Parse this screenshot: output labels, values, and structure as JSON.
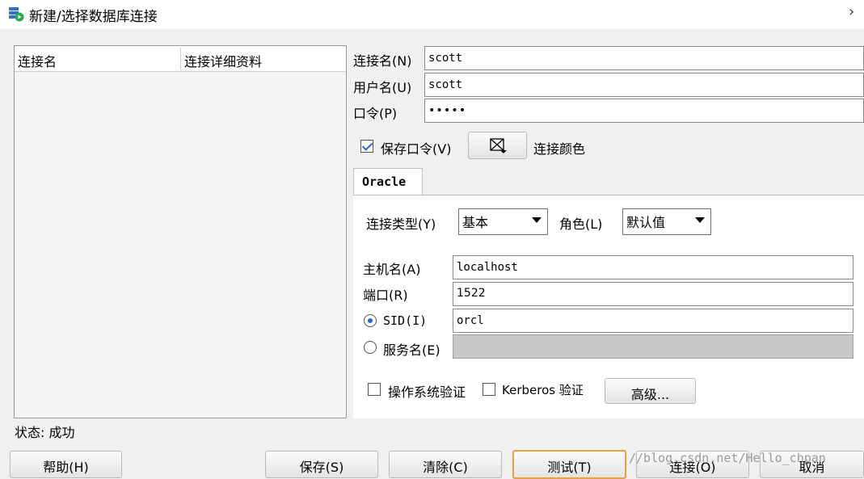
{
  "window": {
    "title": "新建/选择数据库连接",
    "close_symbol": "›"
  },
  "connection_list": {
    "columns": [
      "连接名",
      "连接详细资料"
    ]
  },
  "form": {
    "conn_name_label": "连接名(N)",
    "conn_name_value": "scott",
    "username_label": "用户名(U)",
    "username_value": "scott",
    "password_label": "口令(P)",
    "password_value": "•••••",
    "save_password_label": "保存口令(V)",
    "save_password_checked": true,
    "conn_color_label": "连接颜色"
  },
  "tabs": [
    {
      "label": "Oracle",
      "active": true
    }
  ],
  "oracle": {
    "conn_type_label": "连接类型(Y)",
    "conn_type_value": "基本",
    "role_label": "角色(L)",
    "role_value": "默认值",
    "hostname_label": "主机名(A)",
    "hostname_value": "localhost",
    "port_label": "端口(R)",
    "port_value": "1522",
    "sid_label": "SID(I)",
    "sid_value": "orcl",
    "sid_selected": true,
    "service_label": "服务名(E)",
    "service_value": "",
    "os_auth_label": "操作系统验证",
    "kerberos_label": "Kerberos 验证",
    "advanced_label": "高级..."
  },
  "status": {
    "text": "状态: 成功"
  },
  "buttons": {
    "help": "帮助(H)",
    "save": "保存(S)",
    "clear": "清除(C)",
    "test": "测试(T)",
    "connect": "连接(O)",
    "cancel": "取消"
  },
  "watermark": "//blog.csdn.net/Hello_chpan",
  "colors": {
    "accent": "#2a6ac8",
    "focus_border": "#e8a040",
    "app_icon": "#2f6fd0",
    "app_icon_play": "#2fa84a"
  }
}
